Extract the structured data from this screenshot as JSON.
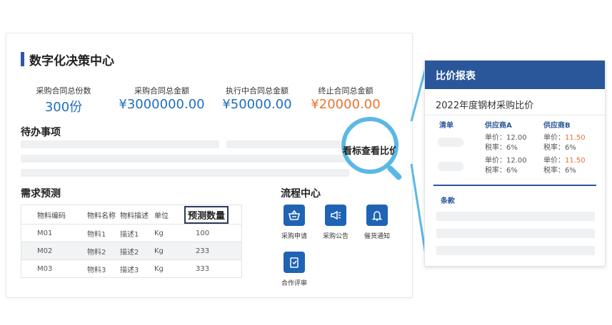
{
  "dashboard": {
    "title": "数字化决策中心",
    "stats": [
      {
        "label": "采购合同总份数",
        "value": "300份"
      },
      {
        "label": "采购合同总金额",
        "value": "¥3000000.00"
      },
      {
        "label": "执行中合同总金额",
        "value": "¥50000.00"
      },
      {
        "label": "终止合同总金额",
        "value": "¥20000.00"
      }
    ],
    "accent_blue": "#1f6fc0",
    "accent_orange": "#e8742e",
    "todo_title": "待办事项",
    "forecast": {
      "title": "需求预测",
      "columns": [
        "物料编码",
        "物料名称",
        "物料描述",
        "单位",
        "预测数量"
      ],
      "rows": [
        [
          "M01",
          "物料1",
          "描述1",
          "Kg",
          "100"
        ],
        [
          "M02",
          "物料2",
          "描述2",
          "Kg",
          "233"
        ],
        [
          "M03",
          "物料3",
          "描述3",
          "Kg",
          "333"
        ]
      ]
    },
    "process": {
      "title": "流程中心",
      "items": [
        {
          "label": "采购申请",
          "icon": "basket-icon"
        },
        {
          "label": "采购公告",
          "icon": "megaphone-icon"
        },
        {
          "label": "催货通知",
          "icon": "bell-icon"
        },
        {
          "label": "合作评审",
          "icon": "clipboard-check-icon"
        }
      ]
    },
    "magnifier_text": "看标查看比价"
  },
  "price_report": {
    "header": "比价报表",
    "subtitle": "2022年度钢材采购比价",
    "columns": [
      "清单",
      "供应商A",
      "供应商B"
    ],
    "rows": [
      {
        "a_price": "单价：12.00",
        "a_tax": "税率：6%",
        "b_price_label": "单价：",
        "b_price": "11.50",
        "b_tax": "税率：6%"
      },
      {
        "a_price": "单价：12.00",
        "a_tax": "税率：6%",
        "b_price_label": "单价：",
        "b_price": "11.50",
        "b_tax": "税率：6%"
      }
    ],
    "terms_label": "条款",
    "header_color": "#2a579a"
  }
}
